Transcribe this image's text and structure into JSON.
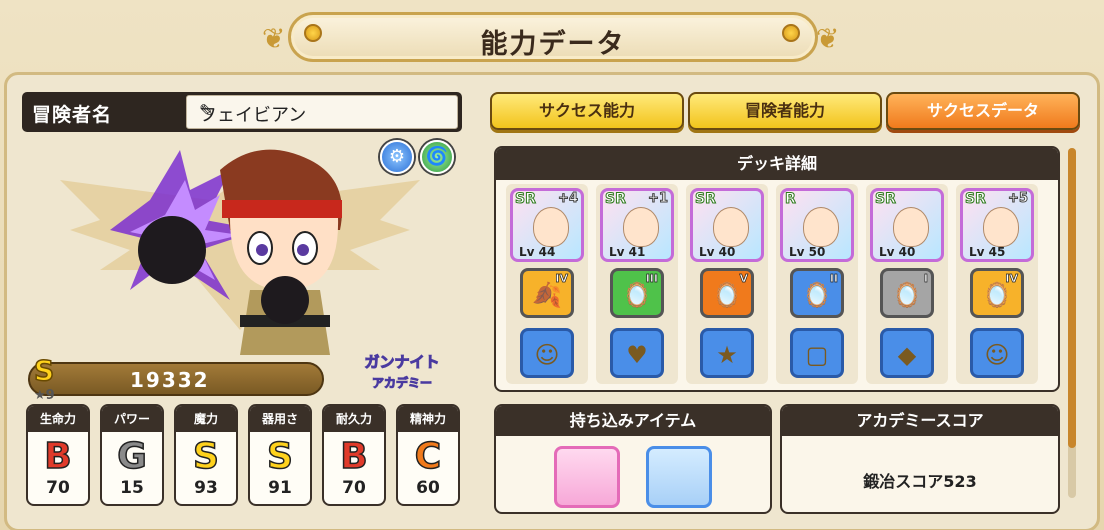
{
  "title": "能力データ",
  "name_label": "冒険者名",
  "name_value": "フェイビアン",
  "rank": "S",
  "star_level": "9",
  "score": "19332",
  "logo_text": "ガンナイトアカデミー",
  "stats": [
    {
      "label": "生命力",
      "grade": "B",
      "value": "70",
      "color": "#e03a2a"
    },
    {
      "label": "パワー",
      "grade": "G",
      "value": "15",
      "color": "#8a8a8a"
    },
    {
      "label": "魔力",
      "grade": "S",
      "value": "93",
      "color": "#ffd21c"
    },
    {
      "label": "器用さ",
      "grade": "S",
      "value": "91",
      "color": "#ffd21c"
    },
    {
      "label": "耐久力",
      "grade": "B",
      "value": "70",
      "color": "#e03a2a"
    },
    {
      "label": "精神力",
      "grade": "C",
      "value": "60",
      "color": "#f07a1c"
    }
  ],
  "tabs": [
    "サクセス能力",
    "冒険者能力",
    "サクセスデータ"
  ],
  "active_tab": 2,
  "deck": {
    "header": "デッキ詳細",
    "cards": [
      {
        "rarity": "SR",
        "plus": "+4",
        "level": "Lv 44",
        "item_rank": "IV",
        "item_glyph": "🍂",
        "item_color": "#f7b22a",
        "gem_glyph": "☺"
      },
      {
        "rarity": "SR",
        "plus": "+1",
        "level": "Lv 41",
        "item_rank": "III",
        "item_glyph": "🪞",
        "item_color": "#4fc24a",
        "gem_glyph": "♥"
      },
      {
        "rarity": "SR",
        "plus": "",
        "level": "Lv 40",
        "item_rank": "V",
        "item_glyph": "🪞",
        "item_color": "#f07a1c",
        "gem_glyph": "★"
      },
      {
        "rarity": "R",
        "plus": "",
        "level": "Lv 50",
        "item_rank": "II",
        "item_glyph": "🪞",
        "item_color": "#4a8ee8",
        "gem_glyph": "▢"
      },
      {
        "rarity": "SR",
        "plus": "",
        "level": "Lv 40",
        "item_rank": "I",
        "item_glyph": "🪞",
        "item_color": "#a5a5a5",
        "gem_glyph": "◆"
      },
      {
        "rarity": "SR",
        "plus": "+5",
        "level": "Lv 45",
        "item_rank": "IV",
        "item_glyph": "🪞",
        "item_color": "#f7b22a",
        "gem_glyph": "☺"
      }
    ]
  },
  "items_panel": {
    "header": "持ち込みアイテム"
  },
  "academy_panel": {
    "header": "アカデミースコア",
    "score_text": "鍛冶スコア523"
  }
}
